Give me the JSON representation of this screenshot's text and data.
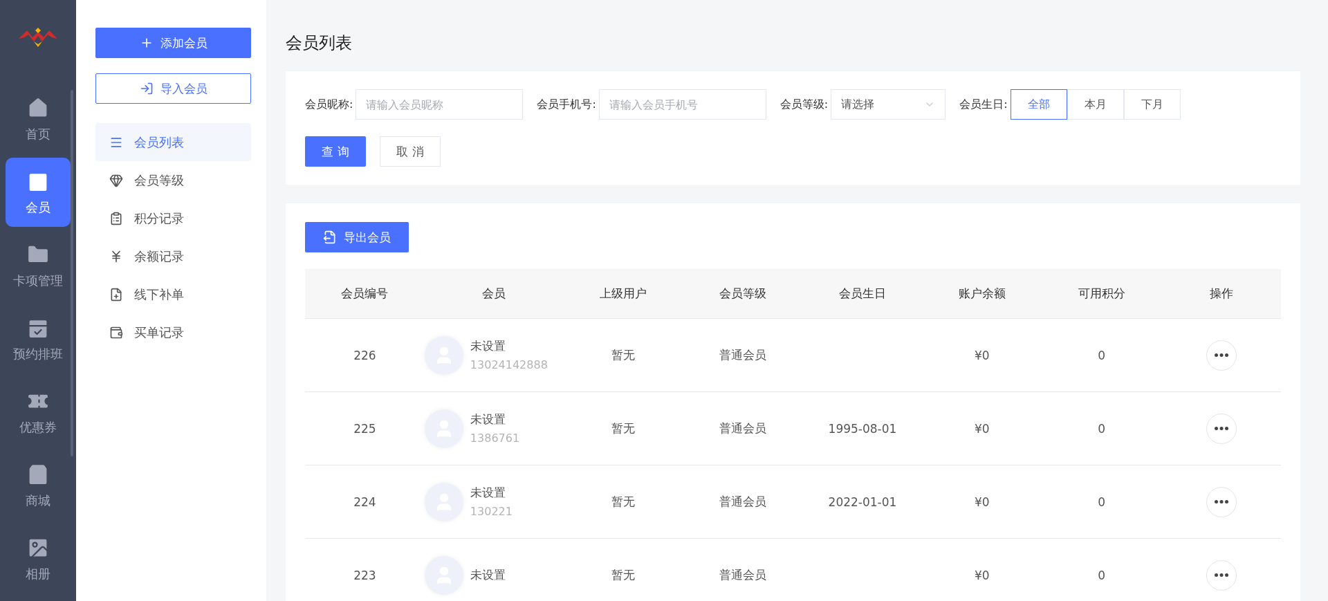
{
  "nav": {
    "items": [
      {
        "label": "首页",
        "selected": false
      },
      {
        "label": "会员",
        "selected": true
      },
      {
        "label": "卡项管理",
        "selected": false
      },
      {
        "label": "预约排班",
        "selected": false
      },
      {
        "label": "优惠券",
        "selected": false
      },
      {
        "label": "商城",
        "selected": false
      },
      {
        "label": "相册",
        "selected": false
      }
    ]
  },
  "submenu": {
    "add_button": "添加会员",
    "import_button": "导入会员",
    "items": [
      {
        "label": "会员列表",
        "selected": true
      },
      {
        "label": "会员等级",
        "selected": false
      },
      {
        "label": "积分记录",
        "selected": false
      },
      {
        "label": "余额记录",
        "selected": false
      },
      {
        "label": "线下补单",
        "selected": false
      },
      {
        "label": "买单记录",
        "selected": false
      }
    ]
  },
  "page_title": "会员列表",
  "filters": {
    "fields": [
      {
        "kind": "input",
        "label": "会员昵称:",
        "placeholder": "请输入会员昵称"
      },
      {
        "kind": "input",
        "label": "会员手机号:",
        "placeholder": "请输入会员手机号"
      },
      {
        "kind": "select",
        "label": "会员等级:",
        "placeholder": "请选择"
      }
    ],
    "birthday": {
      "label": "会员生日:",
      "options": [
        {
          "label": "全部",
          "selected": true
        },
        {
          "label": "本月",
          "selected": false
        },
        {
          "label": "下月",
          "selected": false
        }
      ]
    },
    "search_button": "查 询",
    "cancel_button": "取 消"
  },
  "export_button": "导出会员",
  "table": {
    "columns": [
      "会员编号",
      "会员",
      "上级用户",
      "会员等级",
      "会员生日",
      "账户余额",
      "可用积分",
      "操作"
    ],
    "rows": [
      {
        "id": "226",
        "name": "未设置",
        "phone": "13024142888",
        "parent": "暂无",
        "level": "普通会员",
        "balance": "¥0",
        "points": "0"
      },
      {
        "id": "225",
        "name": "未设置",
        "phone": "1386761",
        "parent": "暂无",
        "level": "普通会员",
        "birthday": "1995-08-01",
        "balance": "¥0",
        "points": "0"
      },
      {
        "id": "224",
        "name": "未设置",
        "phone": "130221",
        "parent": "暂无",
        "level": "普通会员",
        "birthday": "2022-01-01",
        "balance": "¥0",
        "points": "0"
      },
      {
        "id": "223",
        "name": "未设置",
        "parent": "暂无",
        "level": "普通会员",
        "balance": "¥0",
        "points": "0"
      }
    ]
  }
}
